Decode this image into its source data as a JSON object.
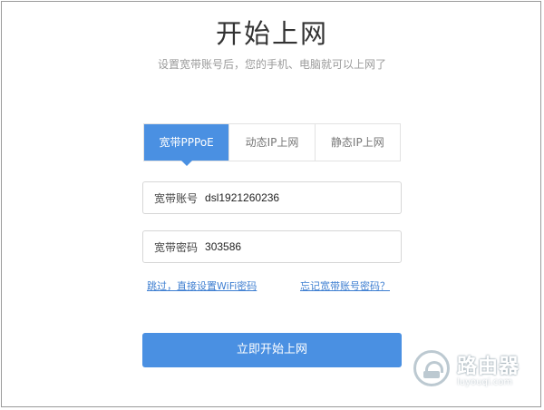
{
  "page": {
    "title": "开始上网",
    "subtitle": "设置宽带账号后，您的手机、电脑就可以上网了"
  },
  "tabs": [
    {
      "label": "宽带PPPoE",
      "active": true
    },
    {
      "label": "动态IP上网",
      "active": false
    },
    {
      "label": "静态IP上网",
      "active": false
    }
  ],
  "form": {
    "account_label": "宽带账号",
    "account_value": "dsl1921260236",
    "password_label": "宽带密码",
    "password_value": "303586",
    "skip_link": "跳过，直接设置WiFi密码",
    "forgot_link": "忘记宽带账号密码？",
    "submit_label": "立即开始上网"
  },
  "watermark": {
    "text": "路由器",
    "domain": "luyouqi.com",
    "icon": "router-logo-icon"
  },
  "colors": {
    "accent": "#4a90e2",
    "link": "#3f7fd1"
  }
}
